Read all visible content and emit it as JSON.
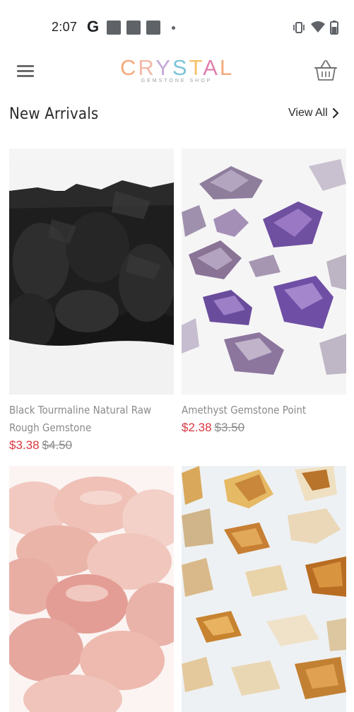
{
  "status_bar": {
    "time": "2:07",
    "google_letter": "G"
  },
  "header": {
    "logo_text": "CRYSTAL",
    "logo_subtext": "GEMSTONE SHOP",
    "logo_colors": [
      "#f4a97b",
      "#f2b8a6",
      "#c4a8d8",
      "#7cc4d8",
      "#f5c26b",
      "#e07fb0"
    ]
  },
  "section": {
    "title": "New Arrivals",
    "view_all_label": "View All"
  },
  "products": [
    {
      "name": "Black Tourmaline Natural Raw Rough Gemstone",
      "price": "$3.38",
      "old_price": "$4.50",
      "image_icon": "black-tourmaline-photo"
    },
    {
      "name": "Amethyst Gemstone Point",
      "price": "$2.38",
      "old_price": "$3.50",
      "image_icon": "amethyst-photo"
    },
    {
      "name": "",
      "price": "",
      "old_price": "",
      "image_icon": "rose-quartz-photo"
    },
    {
      "name": "",
      "price": "",
      "old_price": "",
      "image_icon": "citrine-photo"
    }
  ],
  "colors": {
    "price_red": "#d9363e",
    "text_gray": "#8a8a8a",
    "title_dark": "#2b2b2b"
  }
}
